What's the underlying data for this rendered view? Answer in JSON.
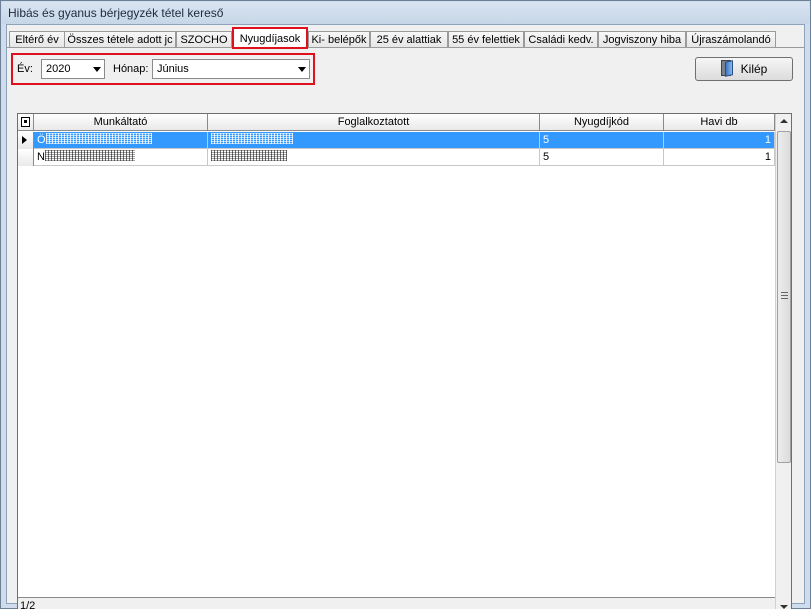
{
  "window": {
    "title": "Hibás és gyanus bérjegyzék tétel kereső"
  },
  "tabs": [
    {
      "label": "Eltérő év"
    },
    {
      "label": "Összes tétele adott jc"
    },
    {
      "label": "SZOCHO"
    },
    {
      "label": "Nyugdíjasok",
      "active": true
    },
    {
      "label": "Ki- belépők"
    },
    {
      "label": "25 év alattiak"
    },
    {
      "label": "55 év felettiek"
    },
    {
      "label": "Családi kedv."
    },
    {
      "label": "Jogviszony hiba"
    },
    {
      "label": "Újraszámolandó"
    }
  ],
  "filter": {
    "year_label": "Év:",
    "year_value": "2020",
    "month_label": "Hónap:",
    "month_value": "Június"
  },
  "exit_button": {
    "label": "Kilép",
    "icon": "door-exit-icon"
  },
  "grid": {
    "columns": [
      "Munkáltató",
      "Foglalkoztatott",
      "Nyugdíjkód",
      "Havi db"
    ],
    "rows": [
      {
        "employer_initial": "Ö",
        "employee": "",
        "code": "5",
        "monthly": "1",
        "selected": true
      },
      {
        "employer_initial": "N",
        "employee": "",
        "code": "5",
        "monthly": "1",
        "selected": false
      }
    ],
    "record_counter": "1/2"
  },
  "colors": {
    "accent_highlight": "#e0111e",
    "selection": "#3399ff"
  }
}
